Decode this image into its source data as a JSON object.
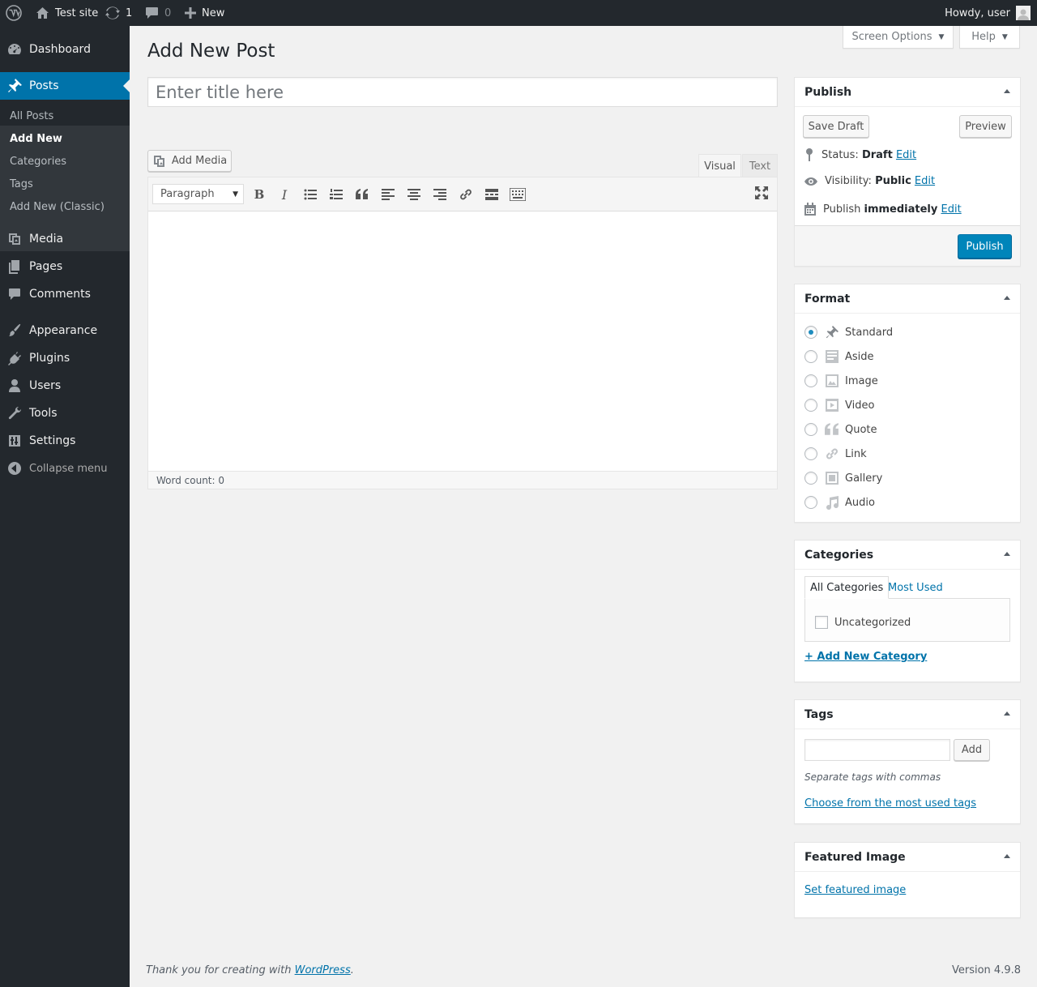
{
  "adminbar": {
    "site_name": "Test site",
    "updates_count": "1",
    "comments_count": "0",
    "new_label": "New",
    "greeting": "Howdy, user"
  },
  "sidebar": {
    "dashboard": "Dashboard",
    "posts": "Posts",
    "posts_submenu": [
      "All Posts",
      "Add New",
      "Categories",
      "Tags",
      "Add New (Classic)"
    ],
    "media": "Media",
    "pages": "Pages",
    "comments": "Comments",
    "appearance": "Appearance",
    "plugins": "Plugins",
    "users": "Users",
    "tools": "Tools",
    "settings": "Settings",
    "collapse": "Collapse menu"
  },
  "screen_meta": {
    "screen_options": "Screen Options",
    "help": "Help"
  },
  "page": {
    "title": "Add New Post",
    "title_placeholder": "Enter title here"
  },
  "editor": {
    "add_media": "Add Media",
    "tab_visual": "Visual",
    "tab_text": "Text",
    "format_select": "Paragraph",
    "word_count": "Word count: 0"
  },
  "publish": {
    "heading": "Publish",
    "save_draft": "Save Draft",
    "preview": "Preview",
    "status_label": "Status:",
    "status_value": "Draft",
    "visibility_label": "Visibility:",
    "visibility_value": "Public",
    "schedule_label": "Publish",
    "schedule_value": "immediately",
    "edit_link": "Edit",
    "publish_button": "Publish"
  },
  "format": {
    "heading": "Format",
    "options": [
      "Standard",
      "Aside",
      "Image",
      "Video",
      "Quote",
      "Link",
      "Gallery",
      "Audio"
    ],
    "selected": "Standard"
  },
  "categories": {
    "heading": "Categories",
    "tab_all": "All Categories",
    "tab_most_used": "Most Used",
    "items": [
      "Uncategorized"
    ],
    "add_new": "+ Add New Category"
  },
  "tags": {
    "heading": "Tags",
    "add_button": "Add",
    "hint": "Separate tags with commas",
    "choose_link": "Choose from the most used tags"
  },
  "featured_image": {
    "heading": "Featured Image",
    "set_link": "Set featured image"
  },
  "footer": {
    "thanks_text": "Thank you for creating with",
    "wordpress_link": "WordPress",
    "period": ".",
    "version": "Version 4.9.8"
  }
}
